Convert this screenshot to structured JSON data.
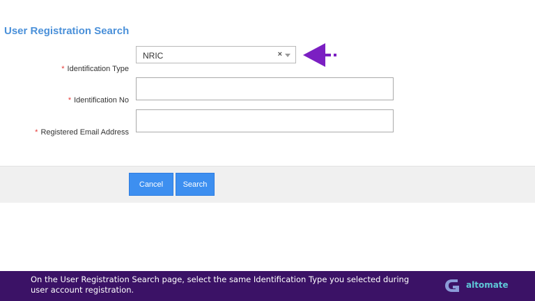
{
  "page": {
    "title": "User Registration Search"
  },
  "form": {
    "required_marker": "*",
    "identification_type": {
      "label": "Identification Type",
      "selected_value": "NRIC",
      "clear_glyph": "×"
    },
    "identification_no": {
      "label": "Identification No",
      "value": "",
      "placeholder": ""
    },
    "email": {
      "label": "Registered Email Address",
      "value": "",
      "placeholder": ""
    }
  },
  "actions": {
    "cancel_label": "Cancel",
    "search_label": "Search"
  },
  "annotation": {
    "arrow_color": "#7b1fc2",
    "arrow_icon": "arrow-left-icon"
  },
  "footer": {
    "instruction": "On the User Registration Search page, select the same Identification Type you selected during user account registration.",
    "brand_name": "altomate",
    "brand_color": "#5ec8d8",
    "background_color": "#3b1266"
  },
  "colors": {
    "title": "#4a90d9",
    "required": "#e53935",
    "button": "#3d8ff0"
  }
}
